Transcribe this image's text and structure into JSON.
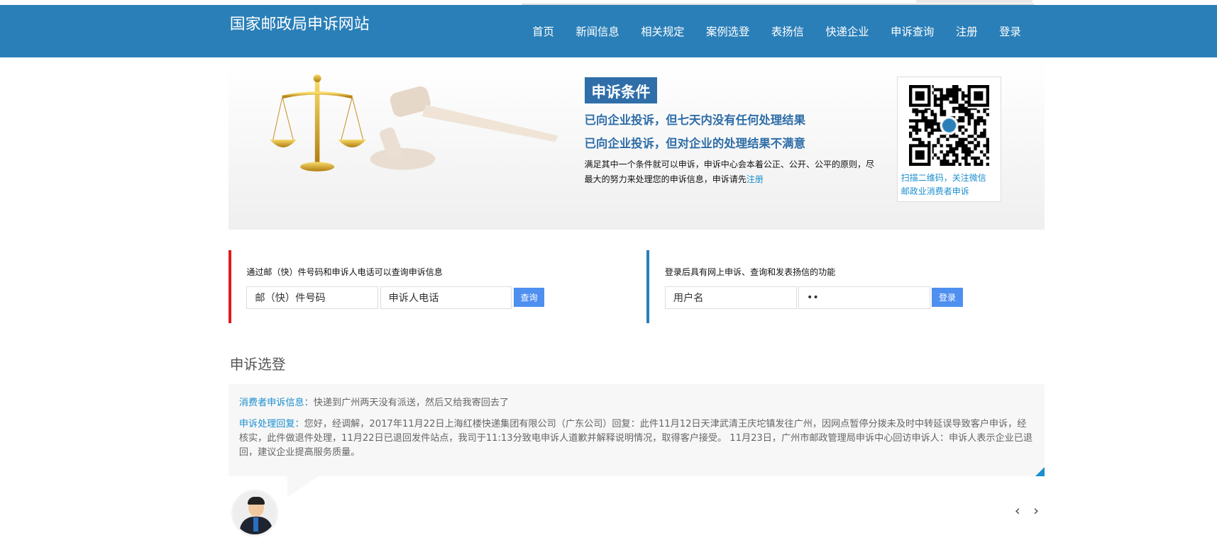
{
  "header": {
    "title": "国家邮政局申诉网站",
    "nav": [
      "首页",
      "新闻信息",
      "相关规定",
      "案例选登",
      "表扬信",
      "快递企业",
      "申诉查询",
      "注册",
      "登录"
    ]
  },
  "banner": {
    "tag": "申诉条件",
    "condition1": "已向企业投诉，但七天内没有任何处理结果",
    "condition2": "已向企业投诉，但对企业的处理结果不满意",
    "description": "满足其中一个条件就可以申诉，申诉中心会本着公正、公开、公平的原则，尽最大的努力来处理您的申诉信息，申诉请先",
    "register_link": "注册",
    "qr_caption1": "扫描二维码，关注微信",
    "qr_caption2": "邮政业消费者申诉"
  },
  "query": {
    "hint": "通过邮（快）件号码和申诉人电话可以查询申诉信息",
    "tracking_value": "邮（快）件号码",
    "phone_value": "申诉人电话",
    "button": "查询"
  },
  "login": {
    "hint": "登录后具有网上申诉、查询和发表扬信的功能",
    "username_value": "用户名",
    "password_value": "••",
    "button": "登录"
  },
  "cases": {
    "title": "申诉选登",
    "consumer_label": "消费者申诉信息：",
    "consumer_text": "快递到广州两天没有派送，然后又给我寄回去了",
    "reply_label": "申诉处理回复：",
    "reply_text": "您好，经调解，2017年11月22日上海红楼快递集团有限公司（广东公司）回复：此件11月12日天津武清王庆坨镇发往广州，因网点暂停分拨未及时中转延误导致客户申诉，经核实，此件做退件处理，11月22日已退回发件站点，我司于11:13分致电申诉人道歉并解释说明情况，取得客户接受。 11月23日，广州市邮政管理局申诉中心回访申诉人：申诉人表示企业已退回，建议企业提高服务质量。",
    "prev": "‹",
    "next": "›"
  },
  "colors": {
    "header": "#2a7fb8",
    "accent": "#1a8ecf",
    "red": "#e01b1b",
    "button": "#4f8ff0"
  }
}
